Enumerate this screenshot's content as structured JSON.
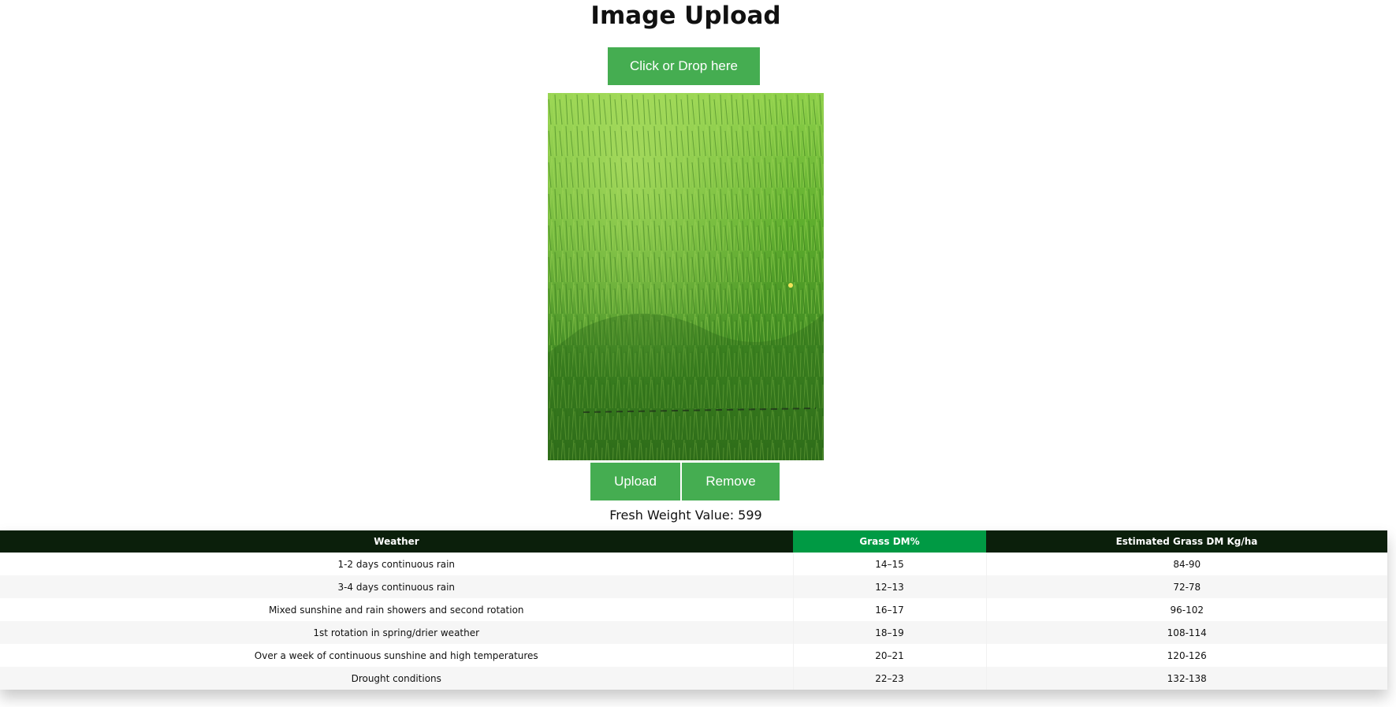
{
  "page": {
    "title": "Image Upload"
  },
  "drop_zone": {
    "label": "Click or Drop here"
  },
  "preview": {
    "icon": "grass-photo"
  },
  "actions": {
    "upload_label": "Upload",
    "remove_label": "Remove"
  },
  "result": {
    "fresh_weight_text": "Fresh Weight Value: 599"
  },
  "table": {
    "headers": [
      "Weather",
      "Grass DM%",
      "Estimated Grass DM Kg/ha"
    ],
    "rows": [
      [
        "1-2 days continuous rain",
        "14–15",
        "84-90"
      ],
      [
        "3-4 days continuous rain",
        "12–13",
        "72-78"
      ],
      [
        "Mixed sunshine and rain showers and second rotation",
        "16–17",
        "96-102"
      ],
      [
        "1st rotation in spring/drier weather",
        "18–19",
        "108-114"
      ],
      [
        "Over a week of continuous sunshine and high temperatures",
        "20–21",
        "120-126"
      ],
      [
        "Drought conditions",
        "22–23",
        "132-138"
      ]
    ]
  },
  "colors": {
    "button_green": "#45ad51",
    "table_header_dark": "#0b1f0b",
    "table_header_highlight": "#009a44"
  }
}
